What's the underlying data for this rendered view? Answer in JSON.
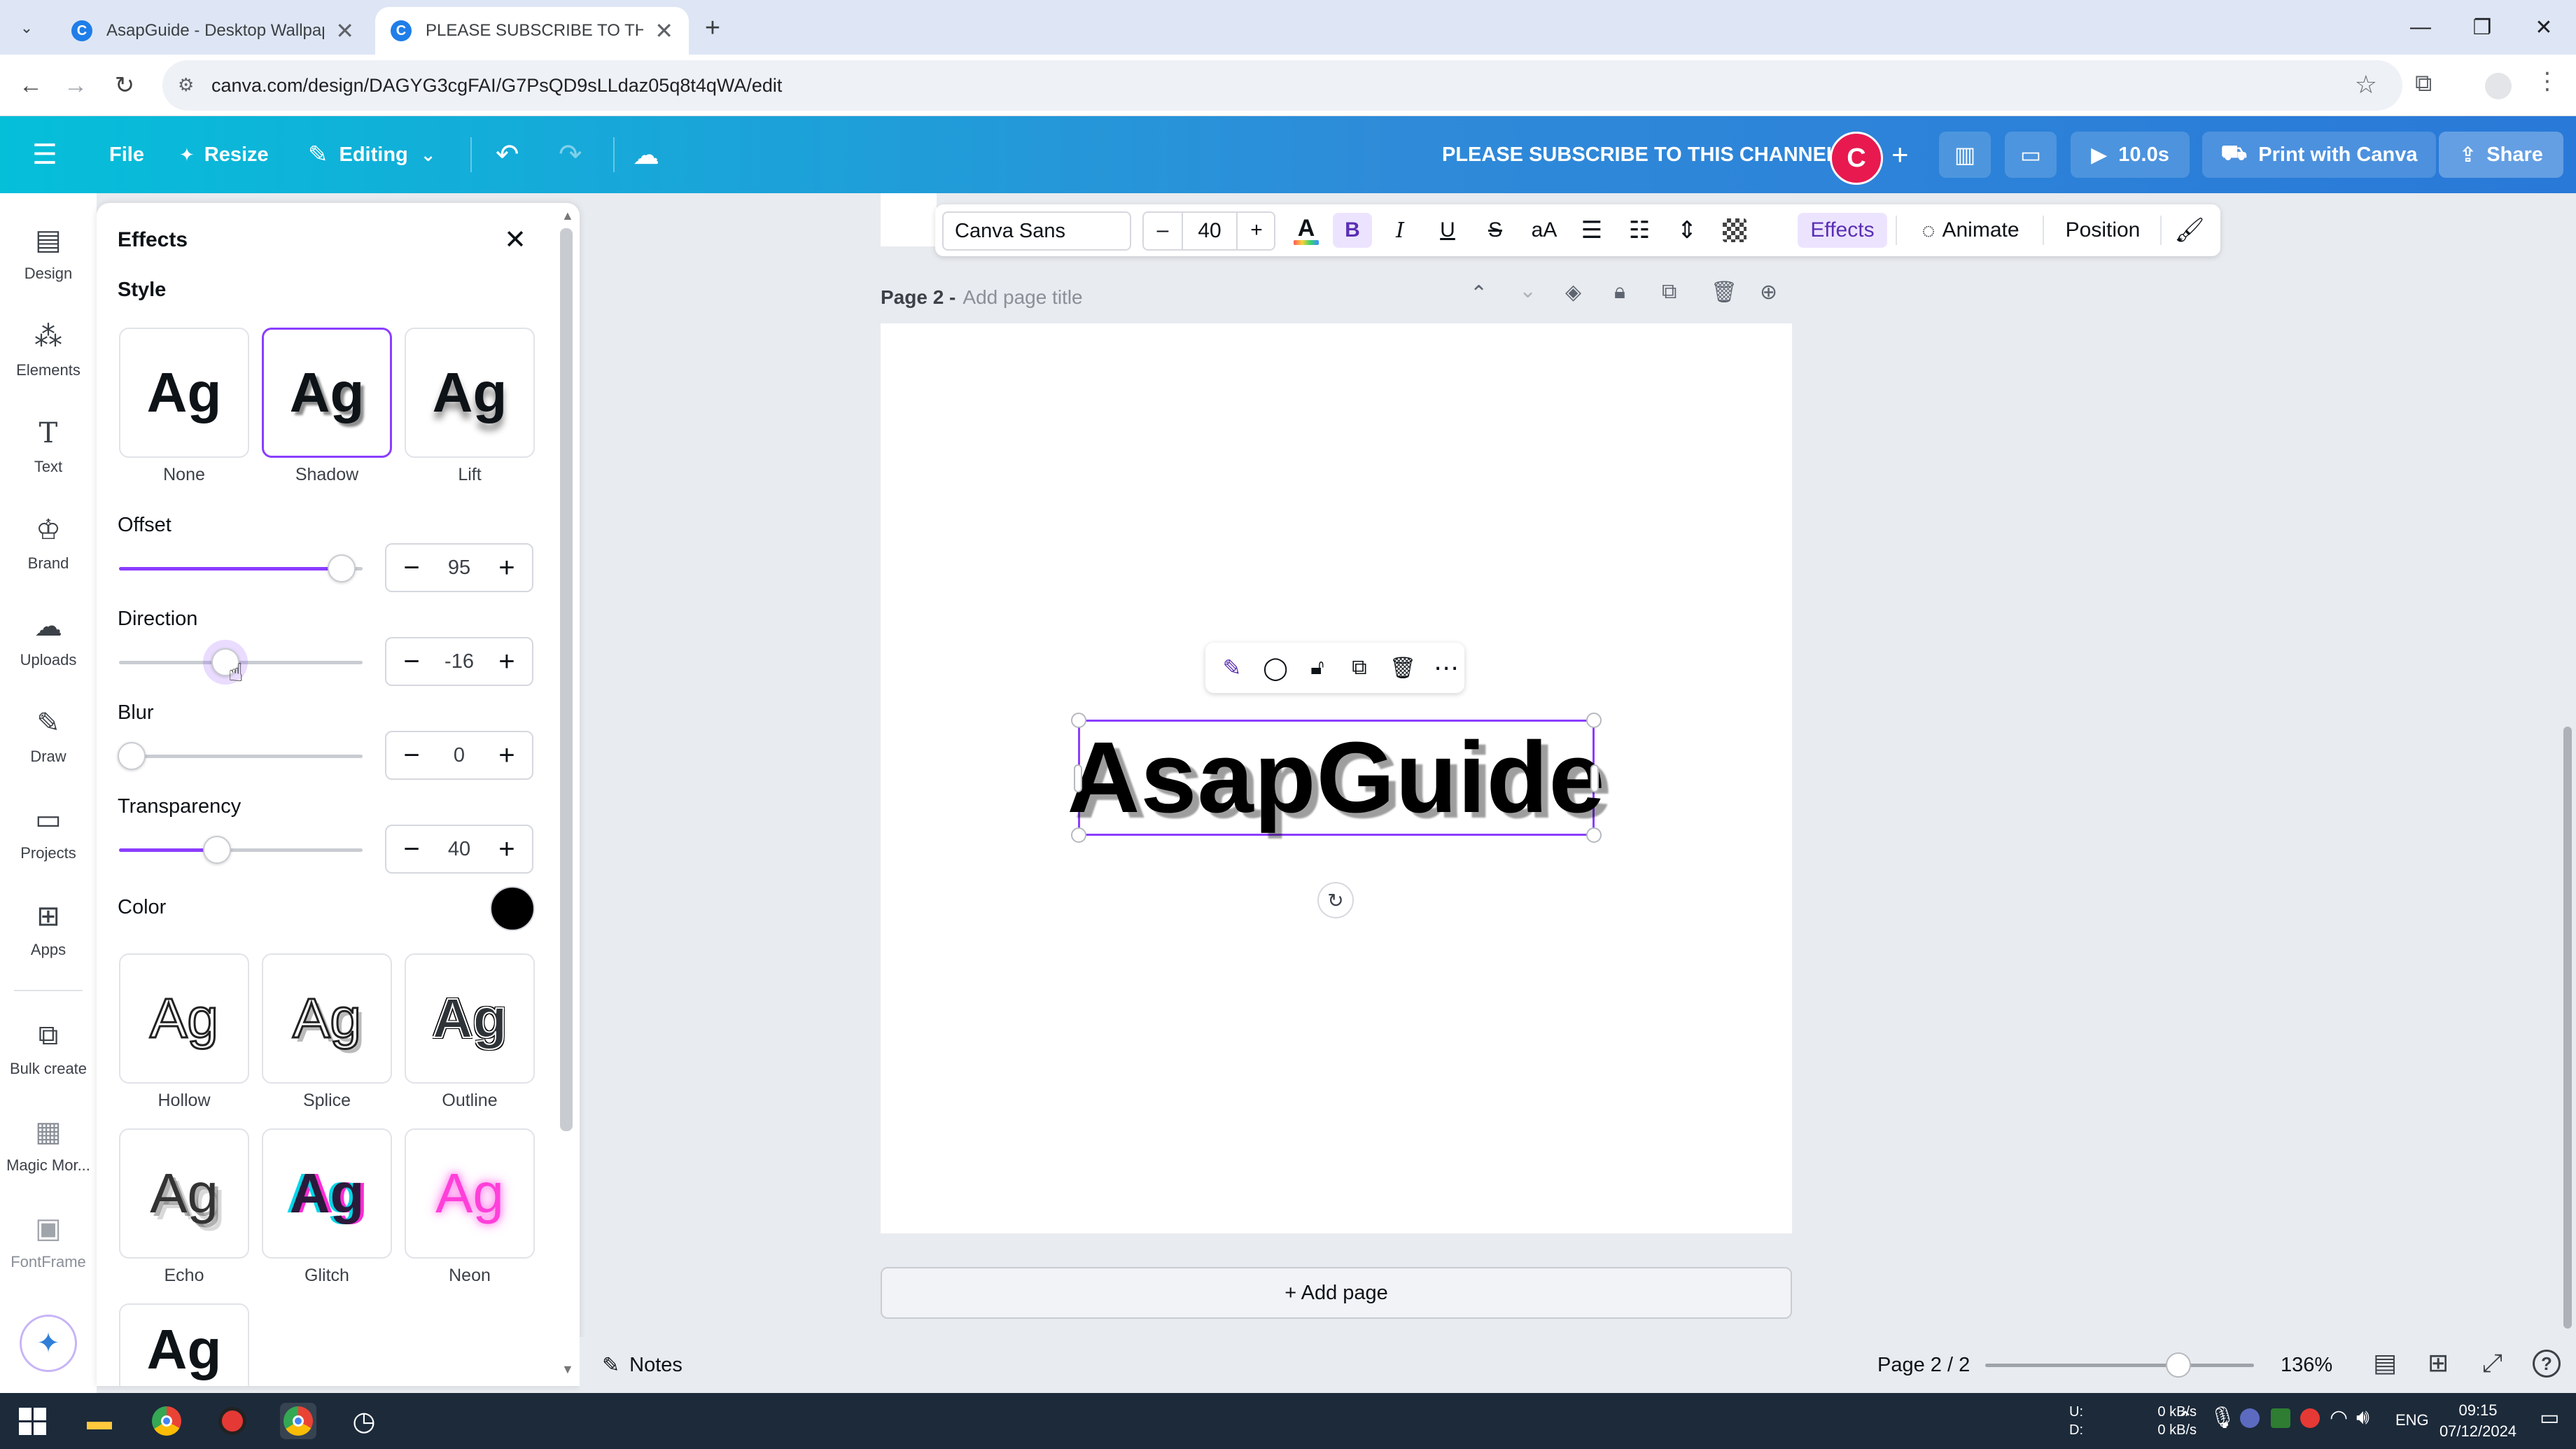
{
  "browser": {
    "tabs": [
      {
        "title": "AsapGuide - Desktop Wallpaper",
        "active": false
      },
      {
        "title": "PLEASE SUBSCRIBE TO THIS CH",
        "active": true
      }
    ],
    "url": "canva.com/design/DAGYG3cgFAI/G7PsQD9sLLdaz05q8t4qWA/edit"
  },
  "header": {
    "file": "File",
    "resize": "Resize",
    "editing": "Editing",
    "title": "PLEASE SUBSCRIBE TO THIS CHANNEL",
    "avatar_letter": "C",
    "timer": "10.0s",
    "print": "Print with Canva",
    "share": "Share"
  },
  "rail": [
    {
      "label": "Design",
      "icon": "design-icon"
    },
    {
      "label": "Elements",
      "icon": "elements-icon"
    },
    {
      "label": "Text",
      "icon": "text-icon"
    },
    {
      "label": "Brand",
      "icon": "brand-icon"
    },
    {
      "label": "Uploads",
      "icon": "uploads-icon"
    },
    {
      "label": "Draw",
      "icon": "draw-icon"
    },
    {
      "label": "Projects",
      "icon": "projects-icon"
    },
    {
      "label": "Apps",
      "icon": "apps-icon"
    },
    {
      "label": "Bulk create",
      "icon": "bulk-create-icon"
    },
    {
      "label": "Magic Mor...",
      "icon": "magic-morph-icon"
    },
    {
      "label": "FontFrame",
      "icon": "fontframe-icon"
    }
  ],
  "effects": {
    "title": "Effects",
    "style_heading": "Style",
    "sample": "Ag",
    "styles_top": [
      "None",
      "Shadow",
      "Lift"
    ],
    "selected_style": "Shadow",
    "offset_label": "Offset",
    "offset": "95",
    "direction_label": "Direction",
    "direction": "-16",
    "blur_label": "Blur",
    "blur": "0",
    "transparency_label": "Transparency",
    "transparency": "40",
    "color_label": "Color",
    "shadow_color": "#000000",
    "styles_more": [
      "Hollow",
      "Splice",
      "Outline",
      "Echo",
      "Glitch",
      "Neon"
    ],
    "slider_positions": {
      "offset": 0.95,
      "direction_deg": -16,
      "blur": 0.0,
      "transparency": 0.4
    }
  },
  "toolbar": {
    "font": "Canva Sans",
    "size": "40",
    "minus": "–",
    "plus": "+",
    "effects": "Effects",
    "animate": "Animate",
    "position": "Position"
  },
  "canvas": {
    "page_label": "Page 2 -",
    "page_title_placeholder": "Add page title",
    "text": "AsapGuide",
    "add_page": "+ Add page"
  },
  "bottom": {
    "notes": "Notes",
    "page_indicator": "Page 2 / 2",
    "zoom": "136%",
    "zoom_level": 0.75
  },
  "taskbar": {
    "net_up": "0 kB/s",
    "net_down": "0 kB/s",
    "u": "U:",
    "d": "D:",
    "lang": "ENG",
    "time": "09:15",
    "date": "07/12/2024"
  },
  "colors": {
    "accent": "#8b3dff",
    "header_start": "#05bfd9",
    "header_end": "#2979d8",
    "avatar": "#e8194f"
  }
}
